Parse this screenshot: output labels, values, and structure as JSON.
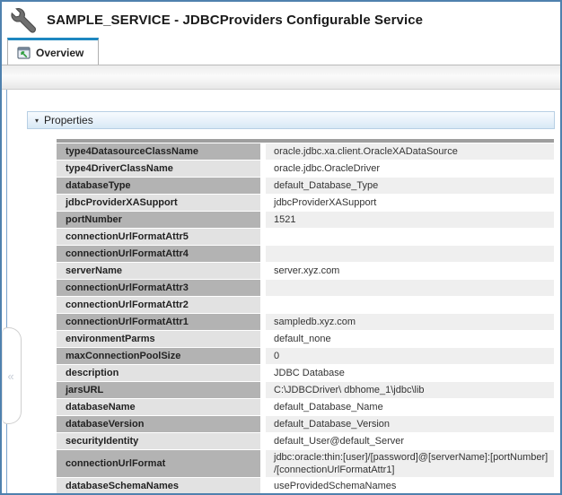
{
  "window": {
    "title": "SAMPLE_SERVICE - JDBCProviders Configurable Service",
    "title_icon": "wrench-icon",
    "border_color": "#4f81ae"
  },
  "tabs": {
    "overview": {
      "label": "Overview",
      "icon": "overview-window-icon",
      "active": true,
      "accent_color": "#1e87c0"
    }
  },
  "panel": {
    "properties_header": {
      "label": "Properties",
      "collapse_indicator": "▾",
      "expanded": true
    },
    "splitter": {
      "collapse_glyph": "«"
    }
  },
  "properties": {
    "rows": [
      {
        "name": "type4DatasourceClassName",
        "value": "oracle.jdbc.xa.client.OracleXADataSource"
      },
      {
        "name": "type4DriverClassName",
        "value": "oracle.jdbc.OracleDriver"
      },
      {
        "name": "databaseType",
        "value": "default_Database_Type"
      },
      {
        "name": "jdbcProviderXASupport",
        "value": "jdbcProviderXASupport"
      },
      {
        "name": "portNumber",
        "value": "1521"
      },
      {
        "name": "connectionUrlFormatAttr5",
        "value": ""
      },
      {
        "name": "connectionUrlFormatAttr4",
        "value": ""
      },
      {
        "name": "serverName",
        "value": "server.xyz.com"
      },
      {
        "name": "connectionUrlFormatAttr3",
        "value": ""
      },
      {
        "name": "connectionUrlFormatAttr2",
        "value": ""
      },
      {
        "name": "connectionUrlFormatAttr1",
        "value": "sampledb.xyz.com"
      },
      {
        "name": "environmentParms",
        "value": "default_none"
      },
      {
        "name": "maxConnectionPoolSize",
        "value": "0"
      },
      {
        "name": "description",
        "value": "JDBC Database"
      },
      {
        "name": "jarsURL",
        "value": "C:\\JDBCDriver\\ dbhome_1\\jdbc\\lib"
      },
      {
        "name": "databaseName",
        "value": "default_Database_Name"
      },
      {
        "name": "databaseVersion",
        "value": "default_Database_Version"
      },
      {
        "name": "securityIdentity",
        "value": "default_User@default_Server"
      },
      {
        "name": "connectionUrlFormat",
        "value": "jdbc:oracle:thin:[user]/[password]@[serverName]:[portNumber]\n/[connectionUrlFormatAttr1]"
      },
      {
        "name": "databaseSchemaNames",
        "value": "useProvidedSchemaNames"
      }
    ],
    "colors": {
      "label_dark": "#b3b3b3",
      "label_light": "#e2e2e2",
      "value_shaded": "#efefef",
      "value_plain": "#ffffff"
    }
  }
}
